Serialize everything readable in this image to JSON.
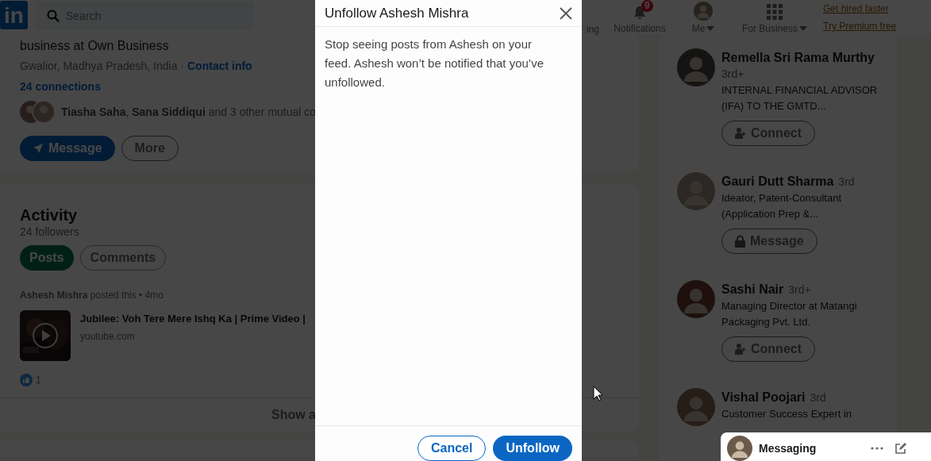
{
  "nav": {
    "logo": "in",
    "search": {
      "placeholder": "Search"
    },
    "items": [
      {
        "label": "ing",
        "kind": "cut"
      },
      {
        "label": "Notifications",
        "kind": "bell",
        "badge": "9"
      },
      {
        "label": "Me",
        "kind": "avatar"
      },
      {
        "label": "For Business",
        "kind": "grid"
      }
    ],
    "premium": [
      "Get hired faster",
      "Try Premium free"
    ]
  },
  "profile": {
    "headline": "business at Own Business",
    "location": "Gwalior, Madhya Pradesh, India ·",
    "contact": "Contact info",
    "connections": "24 connections",
    "mutual": "**Tiasha Saha**, **Sana Siddiqui** and 3 other mutual co",
    "buttons": [
      {
        "label": "Message",
        "kind": "primary"
      },
      {
        "label": "More",
        "kind": "outline"
      }
    ]
  },
  "activity": {
    "title": "Activity",
    "followers": "24 followers",
    "tabs": [
      {
        "label": "Posts",
        "selected": true
      },
      {
        "label": "Comments",
        "selected": false
      }
    ],
    "post": {
      "meta": "**Ashesh Mishra** posted this • 4mo",
      "title": "Jubilee: Voh Tere Mere Ishq Ka | Prime Video |",
      "source": "youtube.com",
      "reactions": "1"
    },
    "show_all": "Show a"
  },
  "suggestions": [
    {
      "name": "Remella Sri Rama Murthy",
      "degree": "3rd+",
      "headline": "INTERNAL FINANCIAL ADVISOR (IFA) TO THE GMTD...",
      "action": {
        "label": "Connect",
        "kind": "connect"
      }
    },
    {
      "name": "Gauri Dutt Sharma",
      "degree": "3rd",
      "headline": "Ideator, Patent-Consultant (Application Prep &...",
      "action": {
        "label": "Message",
        "kind": "message"
      }
    },
    {
      "name": "Sashi Nair",
      "degree": "3rd+",
      "headline": "Managing Director at Matangi Packaging Pvt. Ltd.",
      "action": {
        "label": "Connect",
        "kind": "connect"
      }
    },
    {
      "name": "Vishal Poojari",
      "degree": "3rd",
      "headline": "Customer Success Expert in"
    }
  ],
  "messaging": {
    "label": "Messaging"
  },
  "dialog": {
    "title": "Unfollow Ashesh Mishra",
    "body": "Stop seeing posts from Ashesh on your feed. Ashesh won’t be notified that you’ve unfollowed.",
    "buttons": [
      {
        "label": "Cancel",
        "kind": "secondary"
      },
      {
        "label": "Unfollow",
        "kind": "primary"
      }
    ]
  }
}
